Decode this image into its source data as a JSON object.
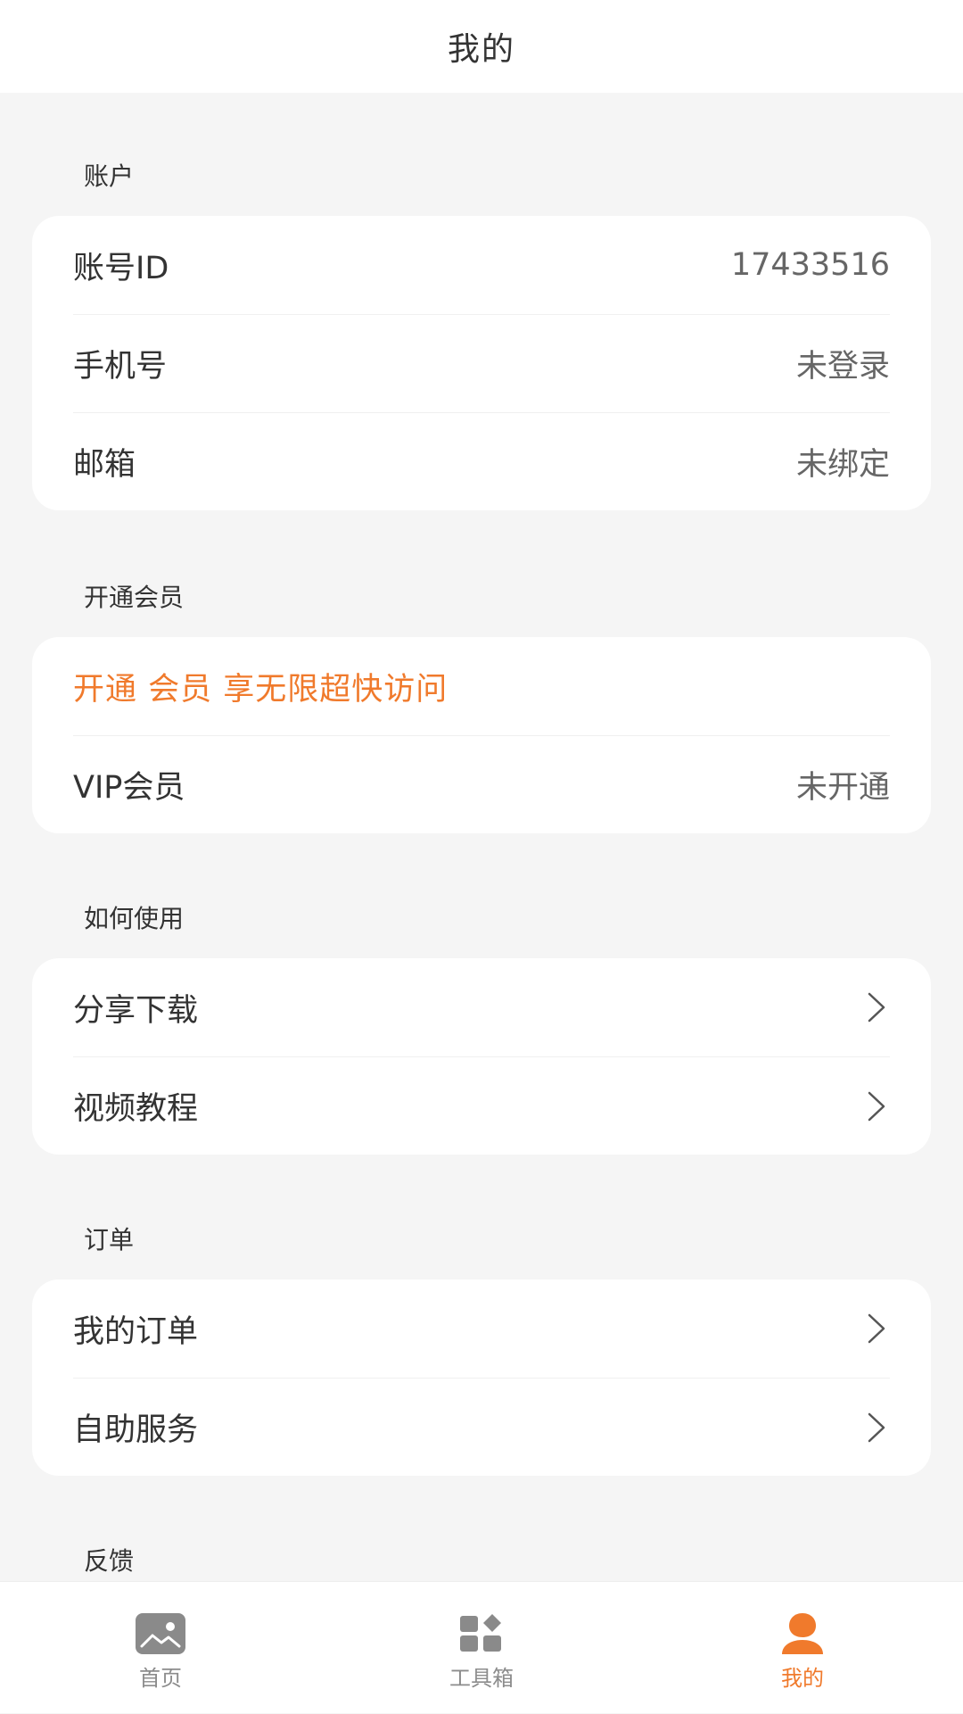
{
  "header": {
    "title": "我的"
  },
  "sections": {
    "account": {
      "title": "账户",
      "rows": [
        {
          "label": "账号ID",
          "value": "17433516"
        },
        {
          "label": "手机号",
          "value": "未登录"
        },
        {
          "label": "邮箱",
          "value": "未绑定"
        }
      ]
    },
    "vip": {
      "title": "开通会员",
      "promo": "开通 会员 享无限超快访问",
      "row": {
        "label": "VIP会员",
        "value": "未开通"
      }
    },
    "howto": {
      "title": "如何使用",
      "rows": [
        {
          "label": "分享下载"
        },
        {
          "label": "视频教程"
        }
      ]
    },
    "orders": {
      "title": "订单",
      "rows": [
        {
          "label": "我的订单"
        },
        {
          "label": "自助服务"
        }
      ]
    },
    "feedback": {
      "title": "反馈"
    }
  },
  "tabbar": {
    "items": [
      {
        "label": "首页",
        "icon": "image-icon",
        "active": false
      },
      {
        "label": "工具箱",
        "icon": "toolbox-icon",
        "active": false
      },
      {
        "label": "我的",
        "icon": "user-icon",
        "active": true
      }
    ]
  },
  "colors": {
    "accent": "#f07a2c",
    "background": "#f5f5f5",
    "card": "#ffffff"
  }
}
